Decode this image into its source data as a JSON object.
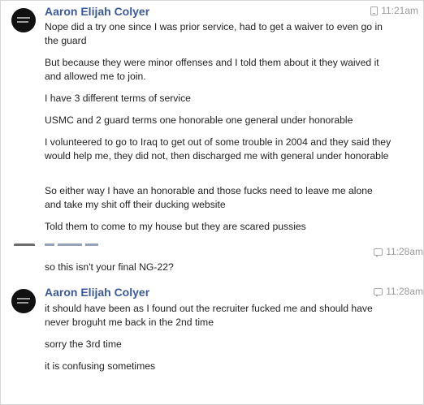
{
  "messages": [
    {
      "sender": "Aaron Elijah Colyer",
      "timestamp": "11:21am",
      "timestamp_icon": "phone-icon",
      "lines": [
        "Nope did a try one since I was prior service, had to get a waiver to even go in the guard",
        "But because they were minor offenses and I told them about it they waived it and allowed me to join.",
        "I have 3 different terms of service",
        "USMC and 2 guard terms one honorable one general under honorable",
        "I volunteered to go to Iraq to get out of some trouble in 2004 and they said they would help me, they did not, then discharged me with general under honorable",
        "So either way I have an honorable and those fucks need to leave me alone and take my shit off their ducking website",
        "Told them to come to my house but they are scared pussies"
      ]
    },
    {
      "sender": "",
      "timestamp": "11:28am",
      "timestamp_icon": "chat-icon",
      "lines": [
        "so this isn't your final NG-22?"
      ]
    },
    {
      "sender": "Aaron Elijah Colyer",
      "timestamp": "11:28am",
      "timestamp_icon": "chat-icon",
      "lines": [
        "it should have been as I found out the recruiter fucked me and should have never broguht me back in the 2nd time",
        "sorry the 3rd time",
        "it is confusing sometimes"
      ]
    }
  ]
}
